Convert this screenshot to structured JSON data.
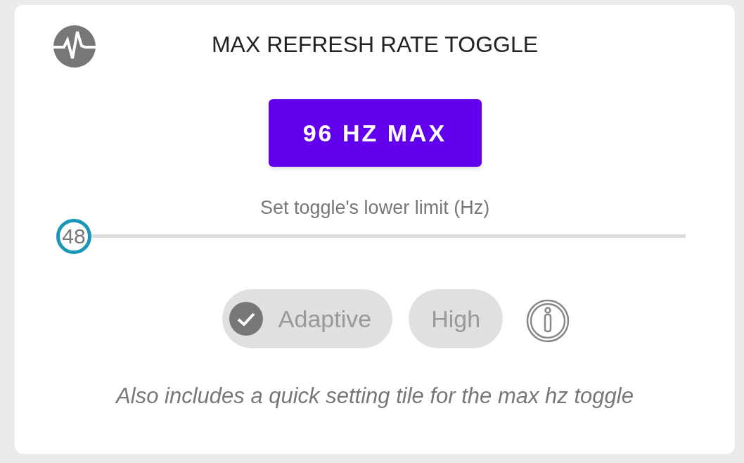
{
  "card": {
    "title": "MAX REFRESH RATE TOGGLE"
  },
  "toggle_button": {
    "label": "96 HZ MAX"
  },
  "slider": {
    "label": "Set toggle's lower limit (Hz)",
    "value": "48",
    "level": 0
  },
  "chips": [
    {
      "label": "Adaptive",
      "selected": true
    },
    {
      "label": "High",
      "selected": false
    }
  ],
  "footnote": "Also includes a quick setting tile for the max hz toggle"
}
